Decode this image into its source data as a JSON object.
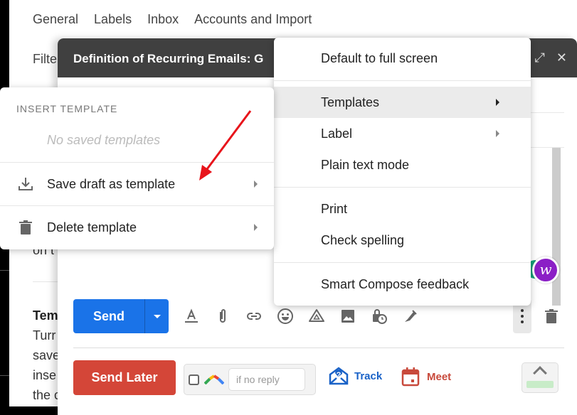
{
  "settings": {
    "tabs": [
      "General",
      "Labels",
      "Inbox",
      "Accounts and Import"
    ],
    "second_row_tab": "Filte",
    "background_lines": [
      "on t",
      "Tem",
      "Turr",
      "save",
      "inse",
      "the c"
    ]
  },
  "compose": {
    "title": "Definition of Recurring Emails: G",
    "header_icons": [
      "expand-icon",
      "close-icon"
    ],
    "send_label": "Send",
    "send_later_label": "Send Later",
    "if_no_reply_placeholder": "if no reply",
    "track_label": "Track",
    "meet_label": "Meet",
    "extension_badge_letter": "w",
    "toolbar_icons": [
      "format-text-icon",
      "attach-icon",
      "link-icon",
      "emoji-icon",
      "drive-icon",
      "photo-icon",
      "confidential-mode-icon",
      "signature-icon"
    ]
  },
  "more_options_menu": {
    "items": [
      {
        "label": "Default to full screen",
        "has_submenu": false,
        "active": false
      },
      {
        "label": "Templates",
        "has_submenu": true,
        "active": true
      },
      {
        "label": "Label",
        "has_submenu": true,
        "active": false
      },
      {
        "label": "Plain text mode",
        "has_submenu": false,
        "active": false
      },
      {
        "label": "Print",
        "has_submenu": false,
        "active": false
      },
      {
        "label": "Check spelling",
        "has_submenu": false,
        "active": false
      },
      {
        "label": "Smart Compose feedback",
        "has_submenu": false,
        "active": false
      }
    ]
  },
  "templates_menu": {
    "header": "INSERT TEMPLATE",
    "empty_text": "No saved templates",
    "items": [
      {
        "label": "Save draft as template",
        "icon": "download-icon"
      },
      {
        "label": "Delete template",
        "icon": "trash-icon"
      }
    ]
  },
  "annotation": {
    "arrow_color": "#e8141b"
  },
  "colors": {
    "send_blue": "#1a73e8",
    "send_later_red": "#d44638",
    "header_dark": "#404040",
    "track_blue": "#1a62c7",
    "meet_red": "#c8493b"
  }
}
